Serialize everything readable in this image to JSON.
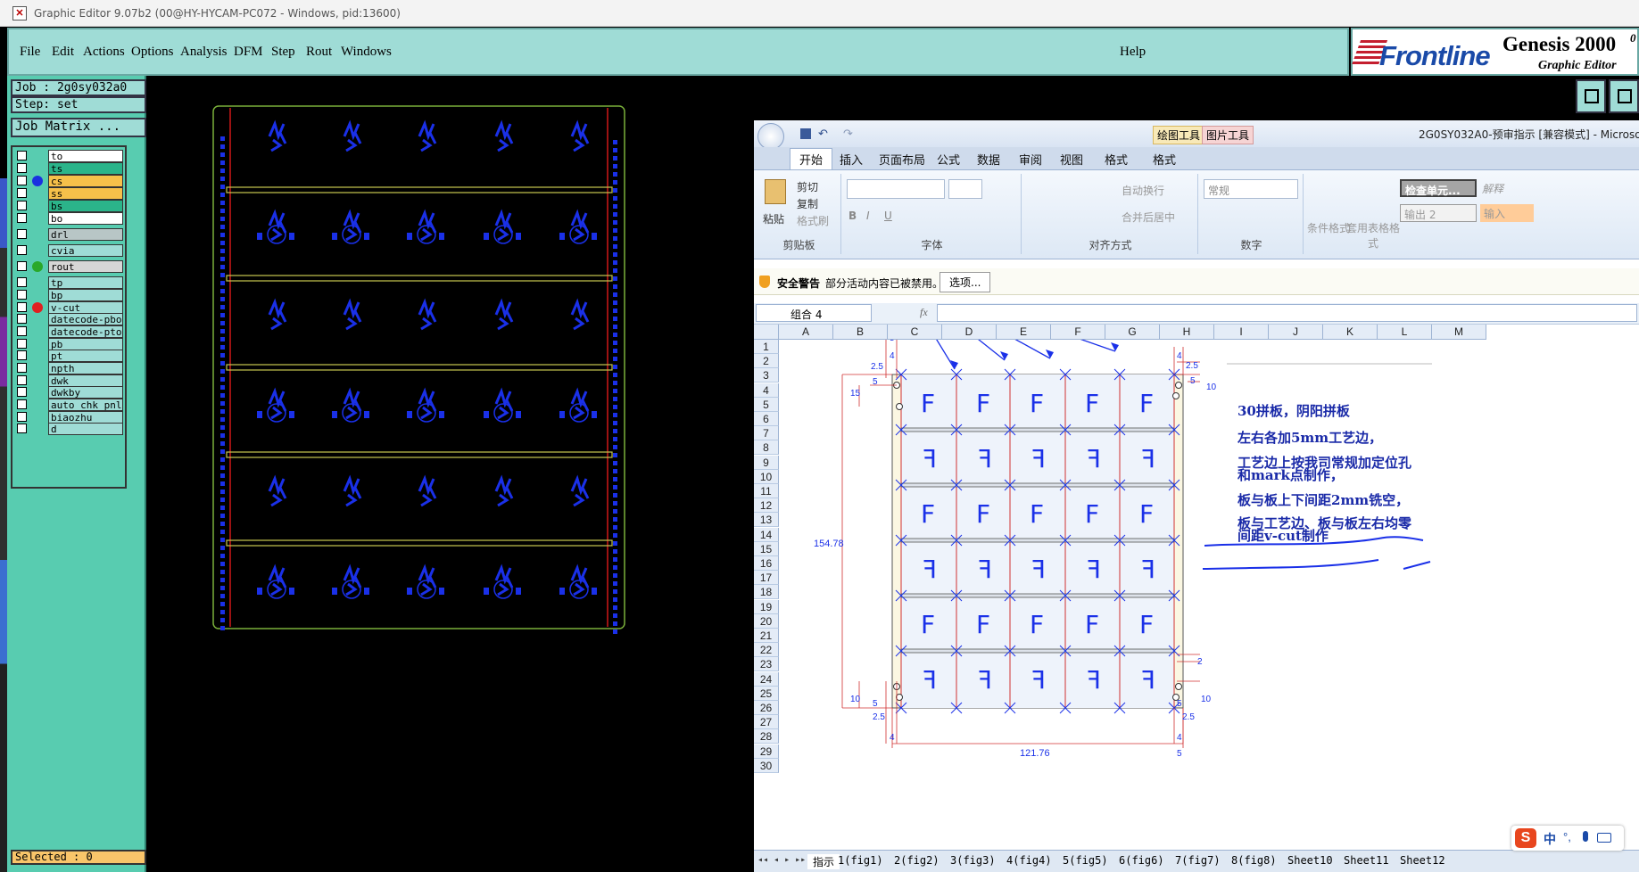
{
  "window": {
    "title": "Graphic Editor 9.07b2 (00@HY-HYCAM-PC072 - Windows, pid:13600)"
  },
  "menu": {
    "file": "File",
    "edit": "Edit",
    "actions": "Actions",
    "options": "Options",
    "analysis": "Analysis",
    "dfm": "DFM",
    "step": "Step",
    "rout": "Rout",
    "windows": "Windows",
    "help": "Help"
  },
  "logo": {
    "brand": "Frontline",
    "product": "Genesis 2000",
    "superscript": "0",
    "subtitle": "Graphic Editor"
  },
  "job": {
    "job_line": "Job : 2g0sy032a0",
    "step_line": "Step: set",
    "matrix_button": "Job Matrix ..."
  },
  "layers": [
    {
      "name": "to",
      "bg": "#ffffff",
      "dot": ""
    },
    {
      "name": "ts",
      "bg": "#2bb48a",
      "dot": ""
    },
    {
      "name": "cs",
      "bg": "#f6c04a",
      "dot": "#1a30e0"
    },
    {
      "name": "ss",
      "bg": "#f6c04a",
      "dot": ""
    },
    {
      "name": "bs",
      "bg": "#2bb48a",
      "dot": ""
    },
    {
      "name": "bo",
      "bg": "#ffffff",
      "dot": ""
    },
    {
      "name": "drl",
      "bg": "#b8c6c6",
      "dot": ""
    },
    {
      "name": "cvia",
      "bg": "#9fdcd6",
      "dot": ""
    },
    {
      "name": "rout",
      "bg": "#d6d6d6",
      "dot": "#2aa82a"
    },
    {
      "name": "tp",
      "bg": "#9fdcd6",
      "dot": ""
    },
    {
      "name": "bp",
      "bg": "#9fdcd6",
      "dot": ""
    },
    {
      "name": "v-cut",
      "bg": "#9fdcd6",
      "dot": "#e02020"
    },
    {
      "name": "datecode-pbo",
      "bg": "#9fdcd6",
      "dot": ""
    },
    {
      "name": "datecode-pto",
      "bg": "#9fdcd6",
      "dot": ""
    },
    {
      "name": "pb",
      "bg": "#9fdcd6",
      "dot": ""
    },
    {
      "name": "pt",
      "bg": "#9fdcd6",
      "dot": ""
    },
    {
      "name": "npth",
      "bg": "#9fdcd6",
      "dot": ""
    },
    {
      "name": "dwk",
      "bg": "#9fdcd6",
      "dot": ""
    },
    {
      "name": "dwkby",
      "bg": "#9fdcd6",
      "dot": ""
    },
    {
      "name": "auto_chk_pnl",
      "bg": "#9fdcd6",
      "dot": ""
    },
    {
      "name": "biaozhu",
      "bg": "#9fdcd6",
      "dot": ""
    },
    {
      "name": "d",
      "bg": "#9fdcd6",
      "dot": ""
    }
  ],
  "status": {
    "selected": "Selected : 0"
  },
  "excel": {
    "file_title": "2G0SY032A0-预审指示 [兼容模式] - Microsoft",
    "context_tabs": {
      "drawing_tools": "绘图工具",
      "picture_tools": "图片工具"
    },
    "tabs": [
      "开始",
      "插入",
      "页面布局",
      "公式",
      "数据",
      "审阅",
      "视图",
      "格式",
      "格式"
    ],
    "ribbon": {
      "paste": "粘贴",
      "cut": "剪切",
      "copy": "复制",
      "format_painter": "格式刷",
      "clipboard": "剪贴板",
      "font": "字体",
      "wrap": "自动换行",
      "merge": "合并后居中",
      "alignment": "对齐方式",
      "number_format": "常规",
      "number": "数字",
      "cond_format": "条件格式",
      "table_format": "套用表格格式",
      "style_check": "检查单元...",
      "style_output": "输出 2",
      "style_calc": "解释",
      "style_input": "输入"
    },
    "security": {
      "label": "安全警告",
      "message": "部分活动内容已被禁用。",
      "options_button": "选项..."
    },
    "name_box": "组合 4",
    "fx": "fx",
    "columns": [
      "A",
      "B",
      "C",
      "D",
      "E",
      "F",
      "G",
      "H",
      "I",
      "J",
      "K",
      "L",
      "M"
    ],
    "rows": [
      "1",
      "2",
      "3",
      "4",
      "5",
      "6",
      "7",
      "8",
      "9",
      "10",
      "11",
      "12",
      "13",
      "14",
      "15",
      "16",
      "17",
      "18",
      "19",
      "20",
      "21",
      "22",
      "23",
      "24",
      "25",
      "26",
      "27",
      "28",
      "29",
      "30"
    ],
    "drawing": {
      "dims": {
        "top_5": "5",
        "left_4": "4",
        "left_2_5": "2.5",
        "left_5": "5",
        "left_15": "15",
        "right_4": "4",
        "right_2_5": "2.5",
        "right_5": "5",
        "right_10": "10",
        "height": "154.78",
        "right_2": "2",
        "bottom_10": "10",
        "bottom_5": "5",
        "bottom_2_5": "2.5",
        "bottom_4": "4",
        "br_5": "5",
        "br_10": "10",
        "br_2_5": "2.5",
        "br_4": "4",
        "br_5b": "5",
        "width": "121.76"
      },
      "letter": "F",
      "letter_mirrored": "F"
    },
    "notes": [
      "30拼板，阴阳拼板",
      "左右各加5mm工艺边，",
      "工艺边上按我司常规加定位孔",
      "和mark点制作，",
      "板与板上下间距2mm铣空，",
      "板与工艺边、板与板左右均零",
      "间距v-cut制作"
    ],
    "sheets": [
      "指示",
      "1(fig1)",
      "2(fig2)",
      "3(fig3)",
      "4(fig4)",
      "5(fig5)",
      "6(fig6)",
      "7(fig7)",
      "8(fig8)",
      "Sheet10",
      "Sheet11",
      "Sheet12"
    ]
  },
  "ime": {
    "lang": "中"
  }
}
